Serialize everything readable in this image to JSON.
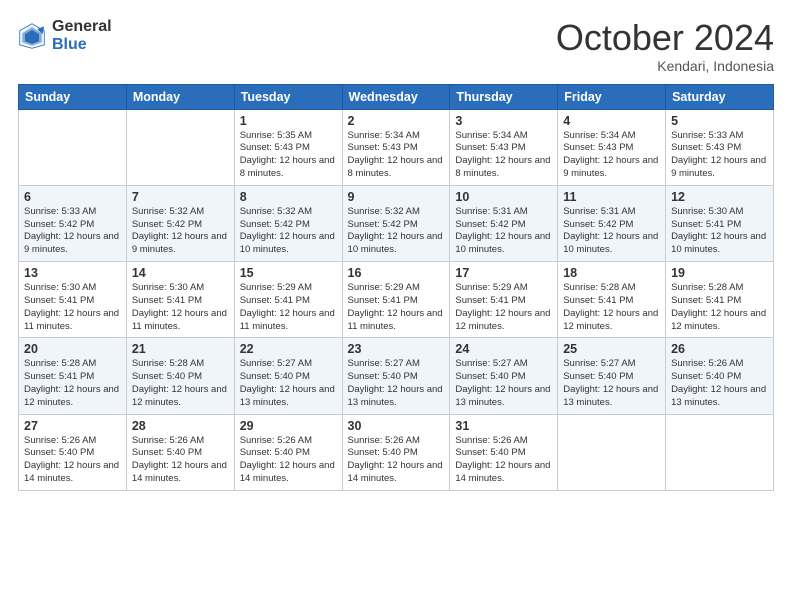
{
  "logo": {
    "general": "General",
    "blue": "Blue"
  },
  "header": {
    "month": "October 2024",
    "location": "Kendari, Indonesia"
  },
  "weekdays": [
    "Sunday",
    "Monday",
    "Tuesday",
    "Wednesday",
    "Thursday",
    "Friday",
    "Saturday"
  ],
  "weeks": [
    [
      {
        "day": "",
        "info": ""
      },
      {
        "day": "",
        "info": ""
      },
      {
        "day": "1",
        "info": "Sunrise: 5:35 AM\nSunset: 5:43 PM\nDaylight: 12 hours and 8 minutes."
      },
      {
        "day": "2",
        "info": "Sunrise: 5:34 AM\nSunset: 5:43 PM\nDaylight: 12 hours and 8 minutes."
      },
      {
        "day": "3",
        "info": "Sunrise: 5:34 AM\nSunset: 5:43 PM\nDaylight: 12 hours and 8 minutes."
      },
      {
        "day": "4",
        "info": "Sunrise: 5:34 AM\nSunset: 5:43 PM\nDaylight: 12 hours and 9 minutes."
      },
      {
        "day": "5",
        "info": "Sunrise: 5:33 AM\nSunset: 5:43 PM\nDaylight: 12 hours and 9 minutes."
      }
    ],
    [
      {
        "day": "6",
        "info": "Sunrise: 5:33 AM\nSunset: 5:42 PM\nDaylight: 12 hours and 9 minutes."
      },
      {
        "day": "7",
        "info": "Sunrise: 5:32 AM\nSunset: 5:42 PM\nDaylight: 12 hours and 9 minutes."
      },
      {
        "day": "8",
        "info": "Sunrise: 5:32 AM\nSunset: 5:42 PM\nDaylight: 12 hours and 10 minutes."
      },
      {
        "day": "9",
        "info": "Sunrise: 5:32 AM\nSunset: 5:42 PM\nDaylight: 12 hours and 10 minutes."
      },
      {
        "day": "10",
        "info": "Sunrise: 5:31 AM\nSunset: 5:42 PM\nDaylight: 12 hours and 10 minutes."
      },
      {
        "day": "11",
        "info": "Sunrise: 5:31 AM\nSunset: 5:42 PM\nDaylight: 12 hours and 10 minutes."
      },
      {
        "day": "12",
        "info": "Sunrise: 5:30 AM\nSunset: 5:41 PM\nDaylight: 12 hours and 10 minutes."
      }
    ],
    [
      {
        "day": "13",
        "info": "Sunrise: 5:30 AM\nSunset: 5:41 PM\nDaylight: 12 hours and 11 minutes."
      },
      {
        "day": "14",
        "info": "Sunrise: 5:30 AM\nSunset: 5:41 PM\nDaylight: 12 hours and 11 minutes."
      },
      {
        "day": "15",
        "info": "Sunrise: 5:29 AM\nSunset: 5:41 PM\nDaylight: 12 hours and 11 minutes."
      },
      {
        "day": "16",
        "info": "Sunrise: 5:29 AM\nSunset: 5:41 PM\nDaylight: 12 hours and 11 minutes."
      },
      {
        "day": "17",
        "info": "Sunrise: 5:29 AM\nSunset: 5:41 PM\nDaylight: 12 hours and 12 minutes."
      },
      {
        "day": "18",
        "info": "Sunrise: 5:28 AM\nSunset: 5:41 PM\nDaylight: 12 hours and 12 minutes."
      },
      {
        "day": "19",
        "info": "Sunrise: 5:28 AM\nSunset: 5:41 PM\nDaylight: 12 hours and 12 minutes."
      }
    ],
    [
      {
        "day": "20",
        "info": "Sunrise: 5:28 AM\nSunset: 5:41 PM\nDaylight: 12 hours and 12 minutes."
      },
      {
        "day": "21",
        "info": "Sunrise: 5:28 AM\nSunset: 5:40 PM\nDaylight: 12 hours and 12 minutes."
      },
      {
        "day": "22",
        "info": "Sunrise: 5:27 AM\nSunset: 5:40 PM\nDaylight: 12 hours and 13 minutes."
      },
      {
        "day": "23",
        "info": "Sunrise: 5:27 AM\nSunset: 5:40 PM\nDaylight: 12 hours and 13 minutes."
      },
      {
        "day": "24",
        "info": "Sunrise: 5:27 AM\nSunset: 5:40 PM\nDaylight: 12 hours and 13 minutes."
      },
      {
        "day": "25",
        "info": "Sunrise: 5:27 AM\nSunset: 5:40 PM\nDaylight: 12 hours and 13 minutes."
      },
      {
        "day": "26",
        "info": "Sunrise: 5:26 AM\nSunset: 5:40 PM\nDaylight: 12 hours and 13 minutes."
      }
    ],
    [
      {
        "day": "27",
        "info": "Sunrise: 5:26 AM\nSunset: 5:40 PM\nDaylight: 12 hours and 14 minutes."
      },
      {
        "day": "28",
        "info": "Sunrise: 5:26 AM\nSunset: 5:40 PM\nDaylight: 12 hours and 14 minutes."
      },
      {
        "day": "29",
        "info": "Sunrise: 5:26 AM\nSunset: 5:40 PM\nDaylight: 12 hours and 14 minutes."
      },
      {
        "day": "30",
        "info": "Sunrise: 5:26 AM\nSunset: 5:40 PM\nDaylight: 12 hours and 14 minutes."
      },
      {
        "day": "31",
        "info": "Sunrise: 5:26 AM\nSunset: 5:40 PM\nDaylight: 12 hours and 14 minutes."
      },
      {
        "day": "",
        "info": ""
      },
      {
        "day": "",
        "info": ""
      }
    ]
  ]
}
